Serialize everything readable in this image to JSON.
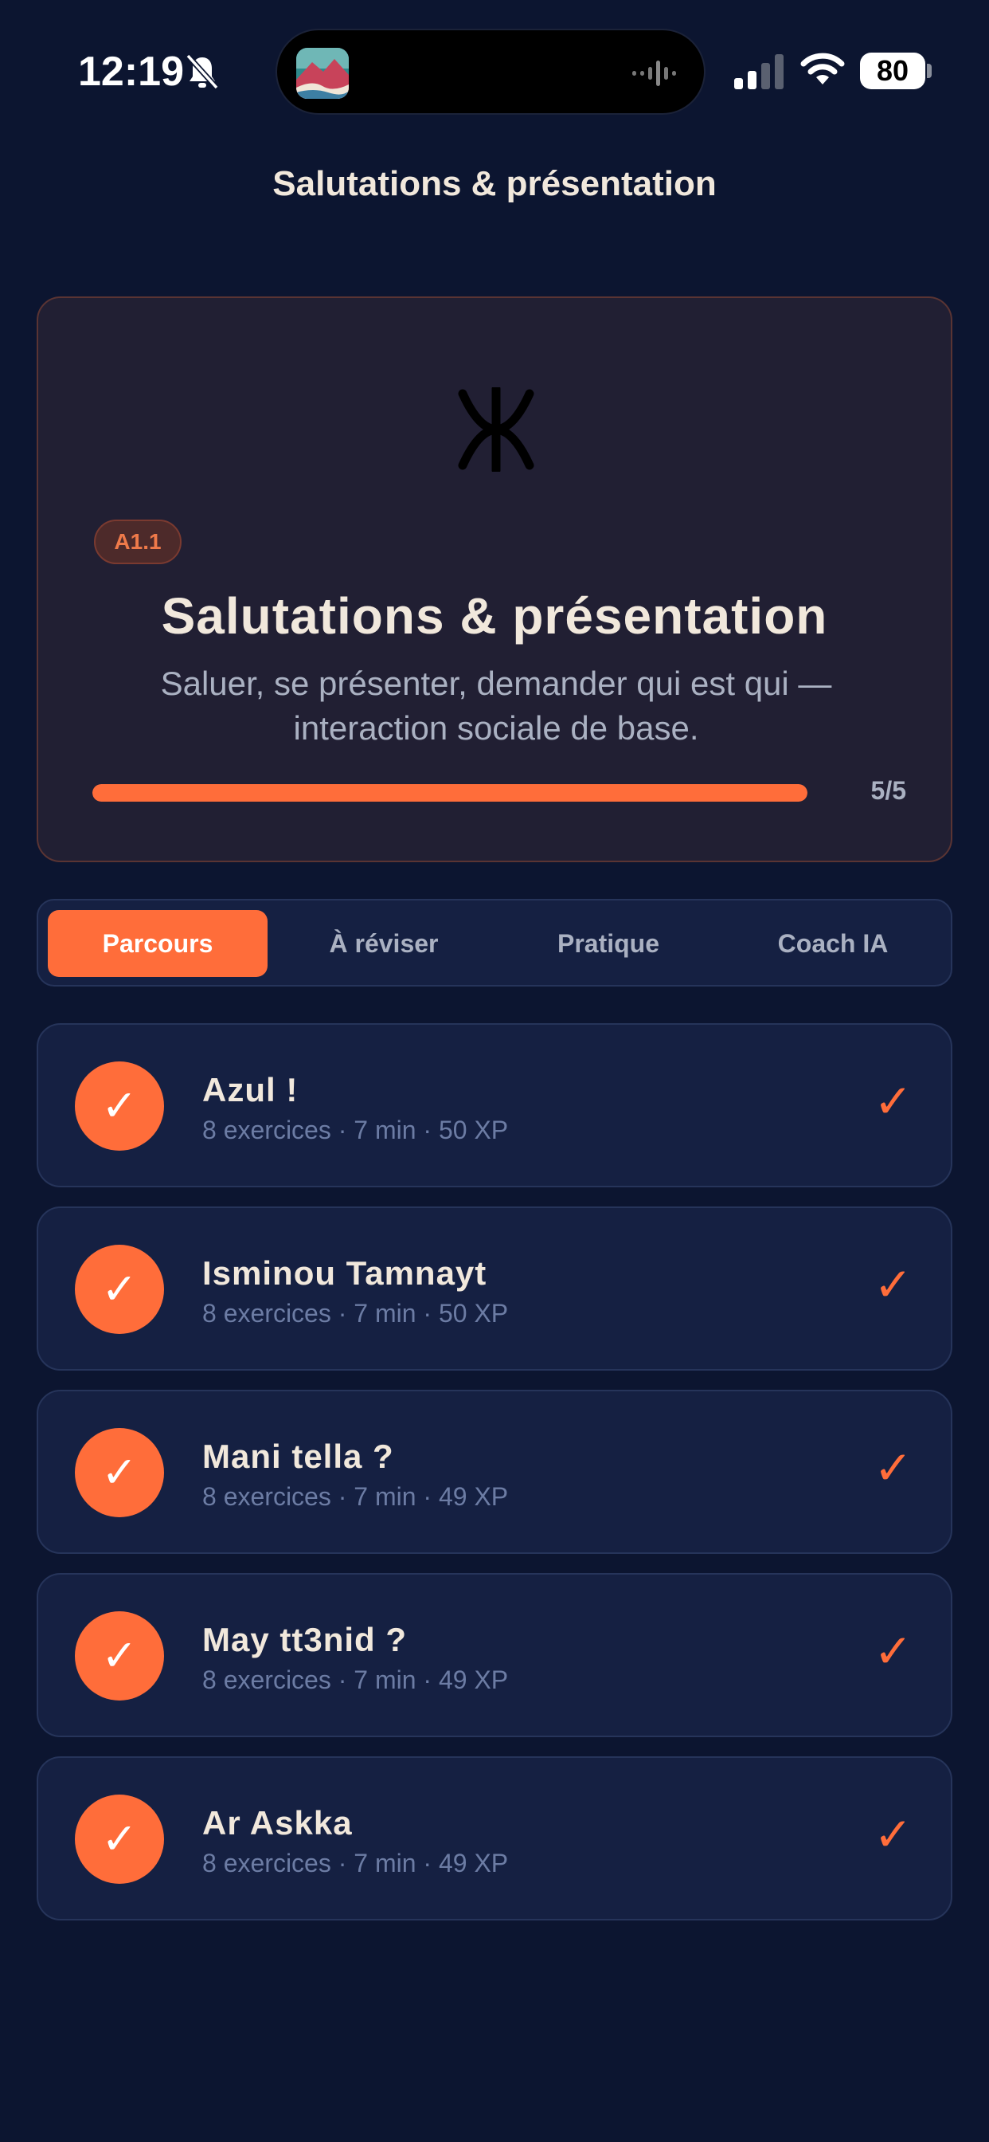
{
  "status_bar": {
    "time": "12:19",
    "battery": "80",
    "icons": [
      "bell-slash-icon",
      "app-artwork-icon",
      "audio-wave-icon",
      "cellular-signal-icon",
      "wifi-icon",
      "battery-icon"
    ]
  },
  "header": {
    "title": "Salutations & présentation"
  },
  "hero": {
    "symbol": "tifinagh-yaz-icon",
    "level": "A1.1",
    "title": "Salutations & présentation",
    "description": "Saluer, se présenter, demander qui est qui — interaction sociale de base.",
    "progress_fraction": 1.0,
    "progress_label": "5/5"
  },
  "tabs": [
    {
      "label": "Parcours",
      "active": true
    },
    {
      "label": "À réviser",
      "active": false
    },
    {
      "label": "Pratique",
      "active": false
    },
    {
      "label": "Coach IA",
      "active": false
    }
  ],
  "lessons": [
    {
      "title": "Azul !",
      "meta": "8 exercices · 7 min · 50 XP",
      "done": true,
      "badge": "✓",
      "check": "✓"
    },
    {
      "title": "Isminou Tamnayt",
      "meta": "8 exercices · 7 min · 50 XP",
      "done": true,
      "badge": "✓",
      "check": "✓"
    },
    {
      "title": "Mani tella ?",
      "meta": "8 exercices · 7 min · 49 XP",
      "done": true,
      "badge": "✓",
      "check": "✓"
    },
    {
      "title": "May tt3nid ?",
      "meta": "8 exercices · 7 min · 49 XP",
      "done": true,
      "badge": "✓",
      "check": "✓"
    },
    {
      "title": "Ar Askka",
      "meta": "8 exercices · 7 min · 49 XP",
      "done": true,
      "badge": "✓",
      "check": "✓"
    }
  ],
  "colors": {
    "background": "#0c1530",
    "accent": "#ff6d3a",
    "card": "#152042",
    "hero_card": "#211f33"
  }
}
